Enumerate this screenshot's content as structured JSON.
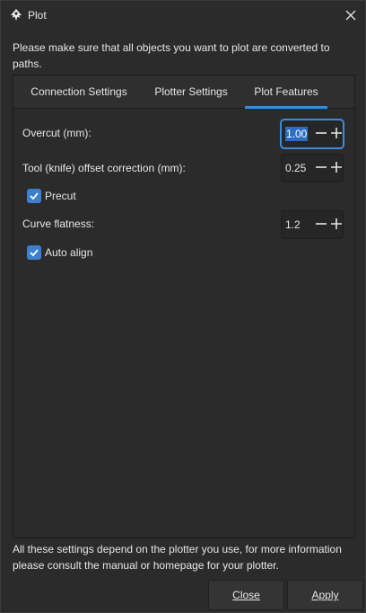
{
  "window": {
    "title": "Plot",
    "icon": "inkscape-logo-icon",
    "close_icon": "close-icon"
  },
  "intro_text": "Please make sure that all objects you want to plot are converted to paths.",
  "tabs": [
    {
      "label": "Connection Settings",
      "active": false
    },
    {
      "label": "Plotter Settings",
      "active": false
    },
    {
      "label": "Plot Features",
      "active": true
    }
  ],
  "features": {
    "overcut": {
      "label": "Overcut (mm):",
      "value": "1.00"
    },
    "tool_offset": {
      "label": "Tool (knife) offset correction (mm):",
      "value": "0.25"
    },
    "precut": {
      "label": "Precut",
      "checked": true
    },
    "curve_flatness": {
      "label": "Curve flatness:",
      "value": "1.2"
    },
    "auto_align": {
      "label": "Auto align",
      "checked": true
    }
  },
  "footer_text": "All these settings depend on the plotter you use, for more information please consult the manual or homepage for your plotter.",
  "buttons": {
    "close_label": "Close",
    "apply_label": "Apply"
  },
  "colors": {
    "accent": "#3d8bd8",
    "background": "#2b2b2b",
    "checkbox": "#3b7fcd"
  }
}
